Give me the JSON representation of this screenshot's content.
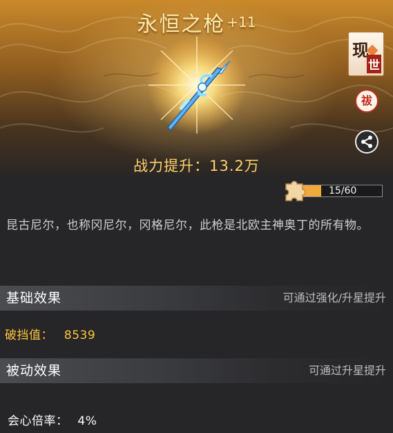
{
  "item": {
    "name": "永恒之枪",
    "level": "+11",
    "power_label": "战力提升：13.2万"
  },
  "badges": {
    "origin_top": "现",
    "origin_bottom": "世",
    "seal": "祓"
  },
  "fragments": {
    "count_text": "15/60",
    "current": 15,
    "total": 60,
    "fill_color": "#f2a93b"
  },
  "description": "昆古尼尔，也称冈尼尔，冈格尼尔，此枪是北欧主神奥丁的所有物。",
  "base_effect": {
    "title": "基础效果",
    "hint": "可通过强化/升星提升",
    "stat_label": "破挡值：",
    "stat_value": "8539",
    "stat_color": "#ffc640"
  },
  "passive_effect": {
    "title": "被动效果",
    "hint": "可通过升星提升",
    "stat_label": "会心倍率：",
    "stat_value": "4%",
    "stat_color": "#ffffff"
  },
  "icons": [
    "spear-weapon-icon",
    "origin-badge-icon",
    "seal-icon",
    "share-icon",
    "puzzle-piece-icon"
  ]
}
